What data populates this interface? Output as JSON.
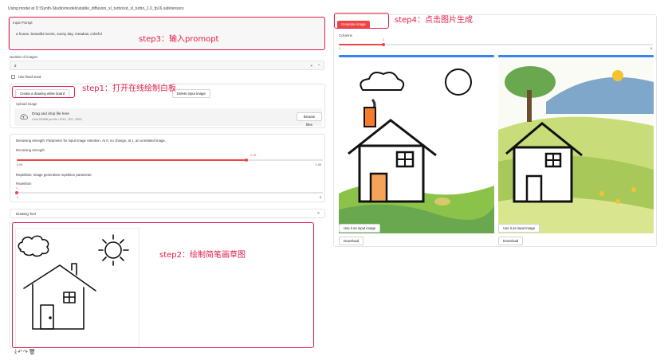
{
  "model_line": "Using model at D:\\Synth-Studio\\models\\stable_diffusion_xl_turbo\\sd_xl_turbo_1.0_fp16.safetensors",
  "prompt": {
    "label": "Input Prompt",
    "value": "a house,   beautiful scene,   sunny day,   meadow,   colorful"
  },
  "num_images": {
    "label": "Number of images",
    "value": "2",
    "clear": "×",
    "chevron": "⌄"
  },
  "fixed_seed": {
    "label": "Use fixed seed"
  },
  "whiteboard": {
    "create_label": "Create a drawing white board",
    "delete_label": "Delete input image",
    "upload_label": "Upload image",
    "drop_text": "Drag and drop file here",
    "limit_text": "Limit 200MB per file • PNG, JPG, JPEG",
    "browse_label": "Browse files"
  },
  "denoise": {
    "desc": "Denoising strength: Parameter for input image retention. At 0, no change; at 1, an unrelated image.",
    "label": "Denoising strength",
    "value": "0.75",
    "min": "0.00",
    "max": "1.00",
    "fraction": 0.75
  },
  "repetition": {
    "desc": "Repetition: Image generation repetition parameter.",
    "label": "Repetition",
    "value": "1",
    "min": "1",
    "max": "8",
    "fraction": 0
  },
  "drawing_tool": {
    "label": "Drawing Tool",
    "chevron": "⌄"
  },
  "generate": {
    "label": "Generate image"
  },
  "columns": {
    "label": "Columns",
    "value": "2",
    "min": "1",
    "max": "8",
    "fraction": 0.143
  },
  "outputs": [
    {
      "use_label": "Use it as input image",
      "download_label": "Download"
    },
    {
      "use_label": "Use it as input image",
      "download_label": "Download"
    }
  ],
  "annotations": {
    "step1": "step1：打开在线绘制白板",
    "step2": "step2：绘制简笔画草图",
    "step3": "step3：输入promopt",
    "step4": "step4：点击图片生成"
  },
  "colors": {
    "accent": "#ef4444",
    "annotation": "#e11d48",
    "bar": "#3b82f6"
  },
  "icons": [
    "cloud-upload-icon",
    "download-icon",
    "undo-icon",
    "redo-icon",
    "trash-icon"
  ]
}
